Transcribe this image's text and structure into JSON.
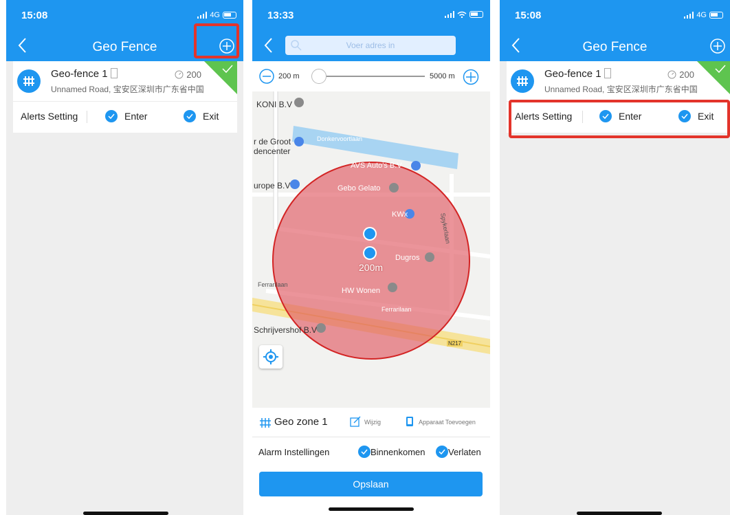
{
  "colors": {
    "primary": "#1e96f0",
    "highlight": "#e3342b",
    "check_corner": "#5ec44f",
    "circle": "#e05a64"
  },
  "panel1": {
    "status_time": "15:08",
    "status_network": "4G",
    "title": "Geo Fence",
    "fence": {
      "name": "Geo-fence 1",
      "radius": "200",
      "address": "Unnamed Road, 宝安区深圳市广东省中国"
    },
    "alerts": {
      "label": "Alerts Setting",
      "enter": "Enter",
      "exit": "Exit"
    }
  },
  "panel2": {
    "status_time": "13:33",
    "search_placeholder": "Voer adres in",
    "zoom_min": "200 m",
    "zoom_max": "5000 m",
    "radius_label": "200m",
    "map_labels": {
      "koni": "KONI B.V",
      "groot": "r de Groot",
      "dencenter": "dencenter",
      "donkervoortlaan": "Donkervoortlaan",
      "avs": "AVS Auto's B.V",
      "europe": "urope B.V",
      "gebo": "Gebo Gelato",
      "kwx": "KWx",
      "dugros": "Dugros",
      "ferrarilaan1": "Ferrarilaan",
      "hwwonen": "HW Wonen",
      "ferrarilaan2": "Ferrarilaan",
      "schrijvershof": "Schrijvershof B.V",
      "n217": "N217",
      "spyker": "Spykerlaan"
    },
    "zone_name": "Geo zone 1",
    "edit_label": "Wijzig",
    "add_device_label": "Apparaat Toevoegen",
    "alarm_label": "Alarm Instellingen",
    "enter": "Binnenkomen",
    "exit": "Verlaten",
    "save": "Opslaan"
  },
  "panel3": {
    "status_time": "15:08",
    "status_network": "4G",
    "title": "Geo Fence",
    "fence": {
      "name": "Geo-fence 1",
      "radius": "200",
      "address": "Unnamed Road, 宝安区深圳市广东省中国"
    },
    "alerts": {
      "label": "Alerts Setting",
      "enter": "Enter",
      "exit": "Exit"
    }
  }
}
